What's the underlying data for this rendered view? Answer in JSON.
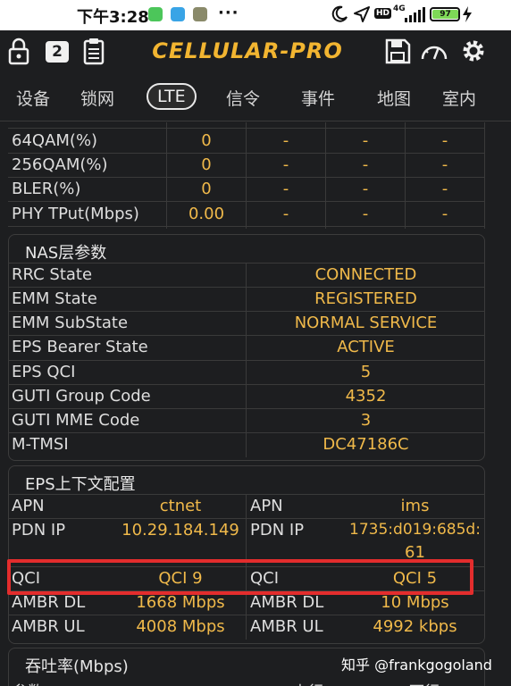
{
  "status_bar": {
    "time": "下午3:28",
    "dots": "···",
    "network": "4G",
    "hd": "HD",
    "battery": "97"
  },
  "header": {
    "title": "CELLULAR-PRO",
    "lock_badge": "",
    "page_badge": "2"
  },
  "tabs": [
    {
      "label": "设备",
      "active": false
    },
    {
      "label": "锁网",
      "active": false
    },
    {
      "label": "LTE",
      "active": true
    },
    {
      "label": "信令",
      "active": false
    },
    {
      "label": "事件",
      "active": false
    },
    {
      "label": "地图",
      "active": false
    },
    {
      "label": "室内",
      "active": false
    }
  ],
  "phy_table": {
    "rows": [
      {
        "label": "64QAM(%)",
        "value": "0",
        "c2": "-",
        "c3": "-",
        "c4": "-"
      },
      {
        "label": "256QAM(%)",
        "value": "0",
        "c2": "-",
        "c3": "-",
        "c4": "-"
      },
      {
        "label": "BLER(%)",
        "value": "0",
        "c2": "-",
        "c3": "-",
        "c4": "-"
      },
      {
        "label": "PHY TPut(Mbps)",
        "value": "0.00",
        "c2": "-",
        "c3": "-",
        "c4": "-"
      }
    ]
  },
  "nas": {
    "title": "NAS层参数",
    "rows": [
      {
        "label": "RRC State",
        "value": "CONNECTED"
      },
      {
        "label": "EMM State",
        "value": "REGISTERED"
      },
      {
        "label": "EMM SubState",
        "value": "NORMAL SERVICE"
      },
      {
        "label": "EPS Bearer State",
        "value": "ACTIVE"
      },
      {
        "label": "EPS QCI",
        "value": "5"
      },
      {
        "label": "GUTI Group Code",
        "value": "4352"
      },
      {
        "label": "GUTI MME Code",
        "value": "3"
      },
      {
        "label": "M-TMSI",
        "value": "DC47186C"
      }
    ]
  },
  "eps": {
    "title": "EPS上下文配置",
    "rows": [
      {
        "l1": "APN",
        "v1": "ctnet",
        "l2": "APN",
        "v2": "ims"
      },
      {
        "l1": "PDN IP",
        "v1": "10.29.184.149",
        "l2": "PDN IP",
        "v2": "1735:d019:685d:",
        "v2b": "61"
      },
      {
        "l1": "QCI",
        "v1": "QCI 9",
        "l2": "QCI",
        "v2": "QCI 5"
      },
      {
        "l1": "AMBR DL",
        "v1": "1668 Mbps",
        "l2": "AMBR DL",
        "v2": "10 Mbps"
      },
      {
        "l1": "AMBR UL",
        "v1": "4008 Mbps",
        "l2": "AMBR UL",
        "v2": "4992 kbps"
      }
    ]
  },
  "throughput": {
    "title": "吞吐率(Mbps)",
    "col0": "参数",
    "col1": "上行",
    "col2": "下行"
  },
  "watermark": "知乎 @frankgogoland",
  "colors": {
    "background": "#1d1e20",
    "value": "#f0b94a",
    "logo": "#f2b531",
    "highlight": "#e32d2d",
    "battery": "#7ed957"
  }
}
